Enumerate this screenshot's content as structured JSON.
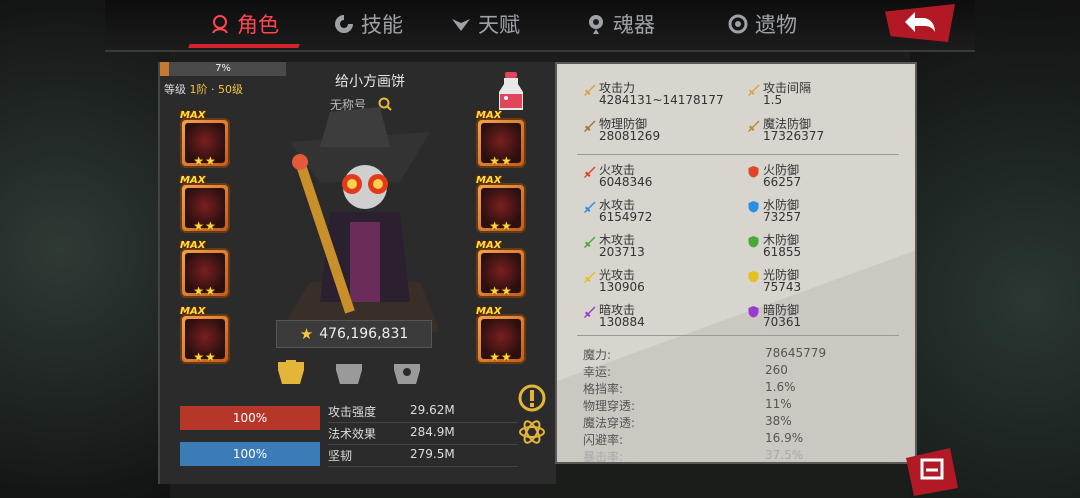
{
  "nav": {
    "tabs": [
      {
        "label": "角色",
        "icon": "character-icon",
        "active": true
      },
      {
        "label": "技能",
        "icon": "skill-icon",
        "active": false
      },
      {
        "label": "天赋",
        "icon": "talent-icon",
        "active": false
      },
      {
        "label": "魂器",
        "icon": "soul-artifact-icon",
        "active": false
      },
      {
        "label": "遗物",
        "icon": "relic-icon",
        "active": false
      }
    ],
    "back_icon": "back-arrow-icon"
  },
  "character": {
    "exp_percent_label": "7%",
    "exp_fraction": 0.07,
    "level_prefix": "等级 ",
    "level_stage": "1阶",
    "level_sep": " · ",
    "level_value": "50级",
    "name": "给小方画饼",
    "title": "无称号",
    "power": "476,196,831"
  },
  "colors": {
    "accent_red": "#d4222f",
    "hp_bar": "#b63628",
    "mp_bar": "#3a7bb8",
    "gold": "#f5c93a"
  },
  "equipment": {
    "badge": "MAX",
    "stars": "★★",
    "left_slots": [
      "slot-1",
      "slot-2",
      "slot-3",
      "slot-4"
    ],
    "right_slots": [
      "slot-5",
      "slot-6",
      "slot-7",
      "slot-8"
    ]
  },
  "bars": {
    "hp_label": "100%",
    "mp_label": "100%",
    "hp_fraction": 1.0,
    "mp_fraction": 1.0
  },
  "sub_stats": [
    {
      "label": "攻击强度",
      "value": "29.62M"
    },
    {
      "label": "法术效果",
      "value": "284.9M"
    },
    {
      "label": "坚韧",
      "value": "279.5M"
    }
  ],
  "stats_main": [
    {
      "name": "攻击力",
      "value": "4284131~14178177",
      "icon": "sword-icon",
      "color": "#d9a441"
    },
    {
      "name": "攻击间隔",
      "value": "1.5",
      "icon": "speed-sword-icon",
      "color": "#d9a441"
    },
    {
      "name": "物理防御",
      "value": "28081269",
      "icon": "shield-icon",
      "color": "#9a7a3a"
    },
    {
      "name": "魔法防御",
      "value": "17326377",
      "icon": "magic-wand-icon",
      "color": "#c08a2a"
    }
  ],
  "stats_elements": [
    {
      "name": "火攻击",
      "value": "6048346",
      "icon": "fire-sword-icon",
      "color": "#e0452a"
    },
    {
      "name": "火防御",
      "value": "66257",
      "icon": "fire-shield-icon",
      "color": "#e0452a"
    },
    {
      "name": "水攻击",
      "value": "6154972",
      "icon": "water-sword-icon",
      "color": "#2a8fe0"
    },
    {
      "name": "水防御",
      "value": "73257",
      "icon": "water-shield-icon",
      "color": "#2a8fe0"
    },
    {
      "name": "木攻击",
      "value": "203713",
      "icon": "wood-sword-icon",
      "color": "#4aa83a"
    },
    {
      "name": "木防御",
      "value": "61855",
      "icon": "wood-shield-icon",
      "color": "#4aa83a"
    },
    {
      "name": "光攻击",
      "value": "130906",
      "icon": "light-sword-icon",
      "color": "#e3c21f"
    },
    {
      "name": "光防御",
      "value": "75743",
      "icon": "light-shield-icon",
      "color": "#e3c21f"
    },
    {
      "name": "暗攻击",
      "value": "130884",
      "icon": "dark-sword-icon",
      "color": "#9a3ad0"
    },
    {
      "name": "暗防御",
      "value": "70361",
      "icon": "dark-shield-icon",
      "color": "#9a3ad0"
    }
  ],
  "stats_misc": [
    {
      "k": "魔力:",
      "v": "78645779"
    },
    {
      "k": "幸运:",
      "v": "260"
    },
    {
      "k": "格挡率:",
      "v": "1.6%"
    },
    {
      "k": "物理穿透:",
      "v": "11%"
    },
    {
      "k": "魔法穿透:",
      "v": "38%"
    },
    {
      "k": "闪避率:",
      "v": "16.9%"
    },
    {
      "k": "暴击率:",
      "v": "37.5%",
      "faded": true
    }
  ]
}
